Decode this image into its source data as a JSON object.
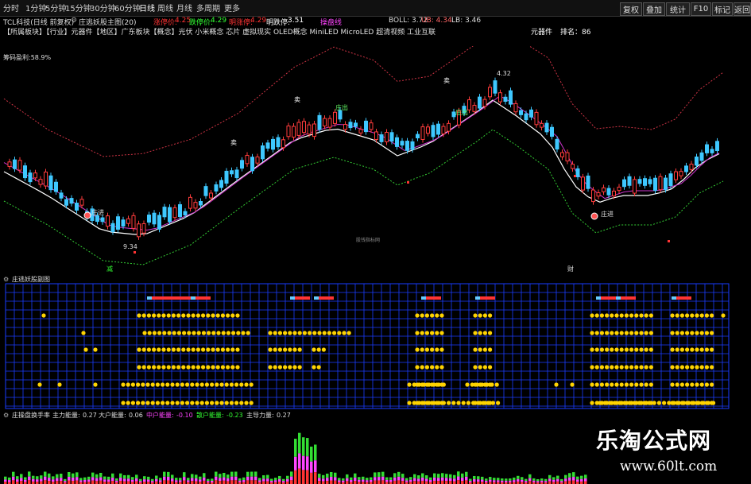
{
  "toolbar": {
    "periods": [
      "分时",
      "1分钟",
      "5分钟",
      "15分钟",
      "30分钟",
      "60分钟",
      "日线",
      "周线",
      "月线",
      "多周期",
      "更多"
    ],
    "right_buttons": [
      "复权",
      "叠加",
      "统计",
      "F10",
      "标记",
      "返回"
    ]
  },
  "info_row": {
    "stock": "TCL科技(日线 前复权)",
    "indicator": "庄逃妖股主图(20)",
    "items": [
      {
        "label": "涨停价:",
        "value": "4.25",
        "color": "#ff3333"
      },
      {
        "label": "跌停价:",
        "value": "4.29",
        "color": "#33ff33"
      },
      {
        "label": "明涨停:",
        "value": "4.29",
        "color": "#ff3333"
      },
      {
        "label": "明跌停:",
        "value": "3.51",
        "color": "#ffffff"
      }
    ],
    "extra": "操盘线",
    "boll": "BOLL: 3.72",
    "ub": "UB: 4.34",
    "lb": "LB: 3.46"
  },
  "sector_row": {
    "text": "【所属板块】【行业】元器件【地区】广东板块【概念】光伏 小米概念 芯片 虚拟现实 OLED概念 MiniLED MicroLED 超清视频 工业互联",
    "right_label": "元器件",
    "rank": "排名：86"
  },
  "main_panel": {
    "chip_label": "筹码盈利:58.9%",
    "annotations": [
      "9.34",
      "4.32",
      "庄进",
      "庄出",
      "庄出",
      "庄进",
      "卖",
      "卖",
      "卖"
    ],
    "center_label": "股钱指标网",
    "bottom_marks": [
      "减",
      "财"
    ]
  },
  "mid_panel": {
    "title": "庄逃妖股副图"
  },
  "bottom_panel": {
    "items": [
      {
        "label": "庄操盘换手率",
        "value": "",
        "color": "#dddddd"
      },
      {
        "label": "主力能量:",
        "value": "0.27",
        "color": "#dddddd"
      },
      {
        "label": "大户能量:",
        "value": "0.06",
        "color": "#dddddd"
      },
      {
        "label": "中户能量:",
        "value": "-0.10",
        "color": "#ff44ff"
      },
      {
        "label": "散户能量:",
        "value": "-0.23",
        "color": "#33ff33"
      },
      {
        "label": "主导力量:",
        "value": "0.27",
        "color": "#dddddd"
      }
    ]
  },
  "watermark": {
    "title": "乐淘公式网",
    "url": "www.60lt.com"
  },
  "colors": {
    "up": "#ff3c3c",
    "down": "#3ec8ff",
    "ma": "#ffffff",
    "ma2": "#cc33cc",
    "band": "#cc3344",
    "lower": "#33cc33",
    "grid": "#1a3dff",
    "dot": "#ffd400"
  }
}
